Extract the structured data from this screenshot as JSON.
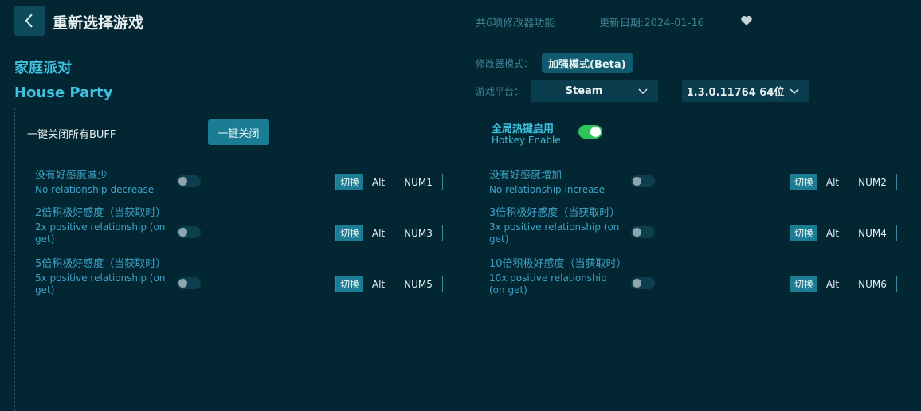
{
  "header": {
    "title": "重新选择游戏",
    "feature_count": "共6项修改器功能",
    "update_date": "更新日期:2024-01-16"
  },
  "game": {
    "name_cn": "家庭派对",
    "name_en": "House Party"
  },
  "mode": {
    "label": "修改器模式：",
    "value": "加强模式(Beta)"
  },
  "platform": {
    "label": "游戏平台：",
    "value": "Steam",
    "version": "1.3.0.11764 64位"
  },
  "buff": {
    "label": "一键关闭所有BUFF",
    "button": "一键关闭"
  },
  "hotkey": {
    "label_cn": "全局热键启用",
    "label_en": "Hotkey Enable",
    "enabled": true
  },
  "features": [
    {
      "cn": "没有好感度减少",
      "en": "No relationship decrease",
      "keys": [
        "切换",
        "Alt",
        "NUM1"
      ],
      "on": false
    },
    {
      "cn": "没有好感度增加",
      "en": "No relationship increase",
      "keys": [
        "切换",
        "Alt",
        "NUM2"
      ],
      "on": false
    },
    {
      "cn": "2倍积极好感度（当获取时）",
      "en": "2x positive relationship (on get)",
      "keys": [
        "切换",
        "Alt",
        "NUM3"
      ],
      "on": false
    },
    {
      "cn": "3倍积极好感度（当获取时）",
      "en": "3x positive relationship (on get)",
      "keys": [
        "切换",
        "Alt",
        "NUM4"
      ],
      "on": false
    },
    {
      "cn": "5倍积极好感度（当获取时）",
      "en": "5x positive relationship (on get)",
      "keys": [
        "切换",
        "Alt",
        "NUM5"
      ],
      "on": false
    },
    {
      "cn": "10倍积极好感度（当获取时）",
      "en": "10x positive relationship (on get)",
      "keys": [
        "切换",
        "Alt",
        "NUM6"
      ],
      "on": false
    }
  ],
  "icons": {
    "back": "chevron-left-icon",
    "heart": "heart-icon",
    "dropdown": "chevron-down-icon"
  }
}
